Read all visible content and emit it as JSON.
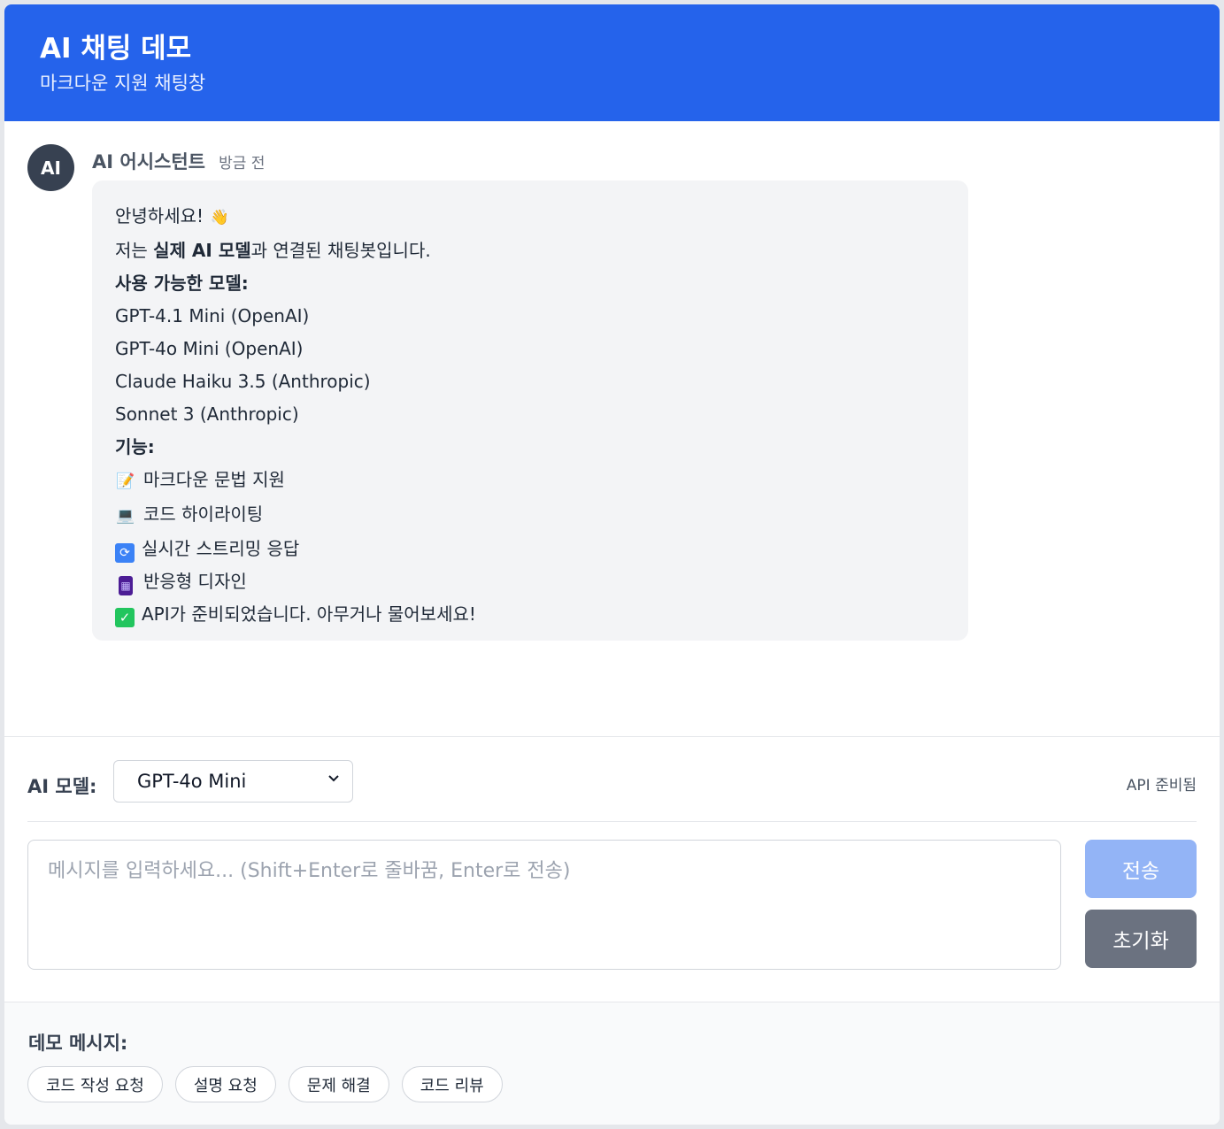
{
  "header": {
    "title": "AI 채팅 데모",
    "subtitle": "마크다운 지원 채팅창"
  },
  "message": {
    "avatar": "AI",
    "sender": "AI 어시스턴트",
    "time": "방금 전",
    "greeting": "안녕하세요!",
    "intro_pre": "저는 ",
    "intro_bold": "실제 AI 모델",
    "intro_post": "과 연결된 채팅봇입니다.",
    "models_heading": "사용 가능한 모델:",
    "models": [
      "GPT-4.1 Mini (OpenAI)",
      "GPT-4o Mini (OpenAI)",
      "Claude Haiku 3.5 (Anthropic)",
      "Sonnet 3 (Anthropic)"
    ],
    "features_heading": "기능:",
    "features": [
      {
        "icon": "memo-icon",
        "label": "마크다운 문법 지원"
      },
      {
        "icon": "laptop-icon",
        "label": "코드 하이라이팅"
      },
      {
        "icon": "refresh-icon",
        "label": "실시간 스트리밍 응답"
      },
      {
        "icon": "mobile-phone-icon",
        "label": "반응형 디자인"
      }
    ],
    "ready": "API가 준비되었습니다. 아무거나 물어보세요!"
  },
  "controls": {
    "model_label": "AI 모델:",
    "model_selected": "GPT-4o Mini",
    "api_status": "API 준비됨",
    "input_placeholder": "메시지를 입력하세요... (Shift+Enter로 줄바꿈, Enter로 전송)",
    "send_label": "전송",
    "reset_label": "초기화"
  },
  "demo": {
    "title": "데모 메시지:",
    "chips": [
      "코드 작성 요청",
      "설명 요청",
      "문제 해결",
      "코드 리뷰"
    ]
  },
  "colors": {
    "header_bg": "#2563eb",
    "send_disabled": "#93b4f6",
    "reset": "#6b7280"
  }
}
